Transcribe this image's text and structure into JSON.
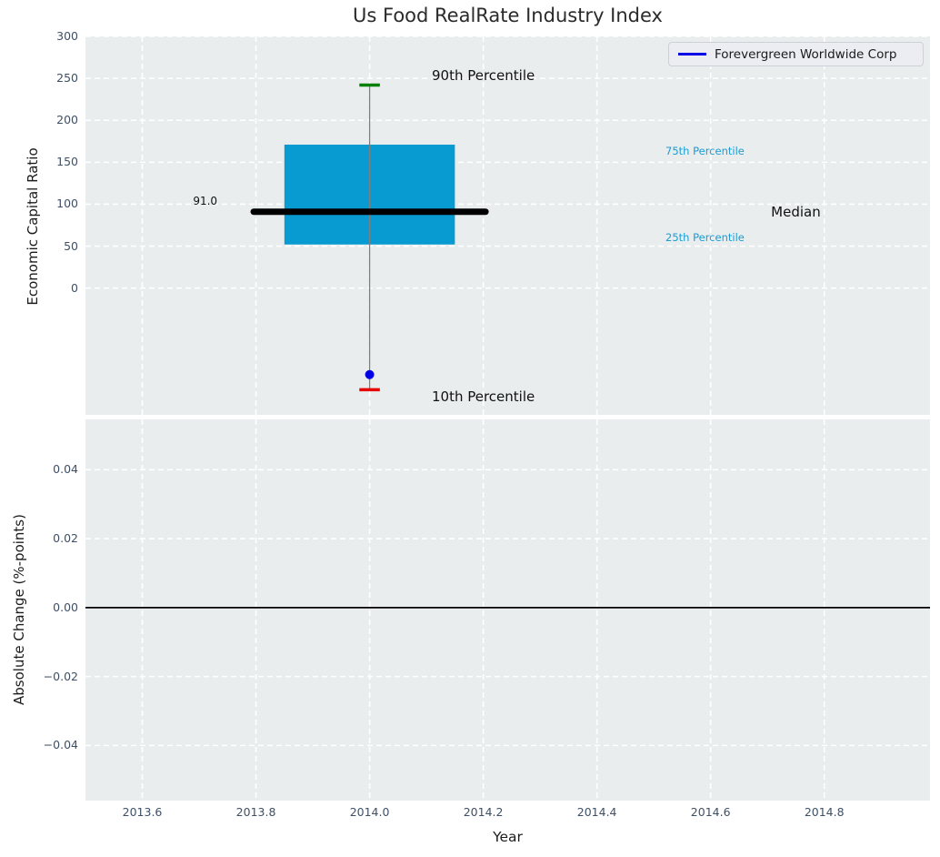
{
  "title": "Us Food RealRate Industry Index",
  "legend": {
    "label": "Forevergreen Worldwide Corp",
    "line_color": "#0000e6"
  },
  "colors": {
    "figure_bg": "#ffffff",
    "plot_bg": "#e9edee",
    "grid": "#ffffff",
    "tick_label": "#3f5066",
    "axis_label": "#1c1c1c",
    "box_fill": "#089bd1",
    "percentile_text": "#1b9cd4",
    "median_line": "#000000",
    "whisker": "#7f7f7f",
    "cap_90th": "#008000",
    "cap_10th": "#e60000",
    "company_blue": "#0000e6"
  },
  "chart_data": [
    {
      "type": "boxplot",
      "subplot": "top",
      "title": "Us Food RealRate Industry Index",
      "ylabel": "Economic Capital Ratio",
      "xlim": [
        2013.5,
        2014.986
      ],
      "ylim": [
        -151,
        300
      ],
      "grid": "white-dashed",
      "legend_position": "upper right",
      "xticks": [
        2013.6,
        2013.8,
        2014.0,
        2014.2,
        2014.4,
        2014.6,
        2014.8
      ],
      "yticks": [
        {
          "value": 0,
          "label": "0"
        },
        {
          "value": 50,
          "label": "50"
        },
        {
          "value": 100,
          "label": "100"
        },
        {
          "value": 150,
          "label": "150"
        },
        {
          "value": 200,
          "label": "200"
        },
        {
          "value": 250,
          "label": "250"
        },
        {
          "value": 300,
          "label": "300"
        }
      ],
      "box": {
        "x": 2014.0,
        "p90": 242,
        "p75": 171,
        "median": 91.0,
        "p25": 52,
        "p10": -121,
        "median_label": "91.0",
        "box_half_width": 0.15,
        "median_half_width": 0.204,
        "cap_half_width": 0.018,
        "box_color": "#089bd1",
        "median_color": "#000000",
        "median_stroke_width": 7,
        "whisker_color": "#7f7f7f",
        "cap_90_color": "#008000",
        "cap_10_color": "#e60000",
        "cap_stroke_width": 3.5
      },
      "company_point": {
        "name": "Forevergreen Worldwide Corp",
        "x": 2014.0,
        "y": -103,
        "color": "#0000e6",
        "radius": 5
      },
      "annotations": [
        {
          "text": "90th Percentile",
          "x": 2014.2,
          "y": 253,
          "color": "#111111",
          "size": 15,
          "anchor": "middle"
        },
        {
          "text": "75th Percentile",
          "x": 2014.59,
          "y": 163,
          "color": "#1b9cd4",
          "size": 11.5,
          "anchor": "middle"
        },
        {
          "text": "Median",
          "x": 2014.75,
          "y": 90,
          "color": "#111111",
          "size": 15,
          "anchor": "middle"
        },
        {
          "text": "25th Percentile",
          "x": 2014.59,
          "y": 60,
          "color": "#1b9cd4",
          "size": 11.5,
          "anchor": "middle"
        },
        {
          "text": "10th Percentile",
          "x": 2014.2,
          "y": -130,
          "color": "#111111",
          "size": 15,
          "anchor": "middle"
        },
        {
          "text": "91.0",
          "x": 2013.732,
          "y": 103,
          "color": "#111111",
          "size": 12,
          "anchor": "end"
        }
      ]
    },
    {
      "type": "line",
      "subplot": "bottom",
      "ylabel": "Absolute Change (%-points)",
      "xlabel": "Year",
      "xlim": [
        2013.5,
        2014.986
      ],
      "ylim": [
        -0.056,
        0.0546
      ],
      "grid": "white-dashed",
      "xticks": [
        {
          "value": 2013.6,
          "label": "2013.6"
        },
        {
          "value": 2013.8,
          "label": "2013.8"
        },
        {
          "value": 2014.0,
          "label": "2014.0"
        },
        {
          "value": 2014.2,
          "label": "2014.2"
        },
        {
          "value": 2014.4,
          "label": "2014.4"
        },
        {
          "value": 2014.6,
          "label": "2014.6"
        },
        {
          "value": 2014.8,
          "label": "2014.8"
        }
      ],
      "yticks": [
        {
          "value": 0.04,
          "label": "0.04"
        },
        {
          "value": 0.02,
          "label": "0.02"
        },
        {
          "value": 0.0,
          "label": "0.00"
        },
        {
          "value": -0.02,
          "label": "−0.02"
        },
        {
          "value": -0.04,
          "label": "−0.04"
        }
      ],
      "zero_line": {
        "y": 0.0,
        "color": "#000000",
        "width": 1.8
      }
    }
  ]
}
